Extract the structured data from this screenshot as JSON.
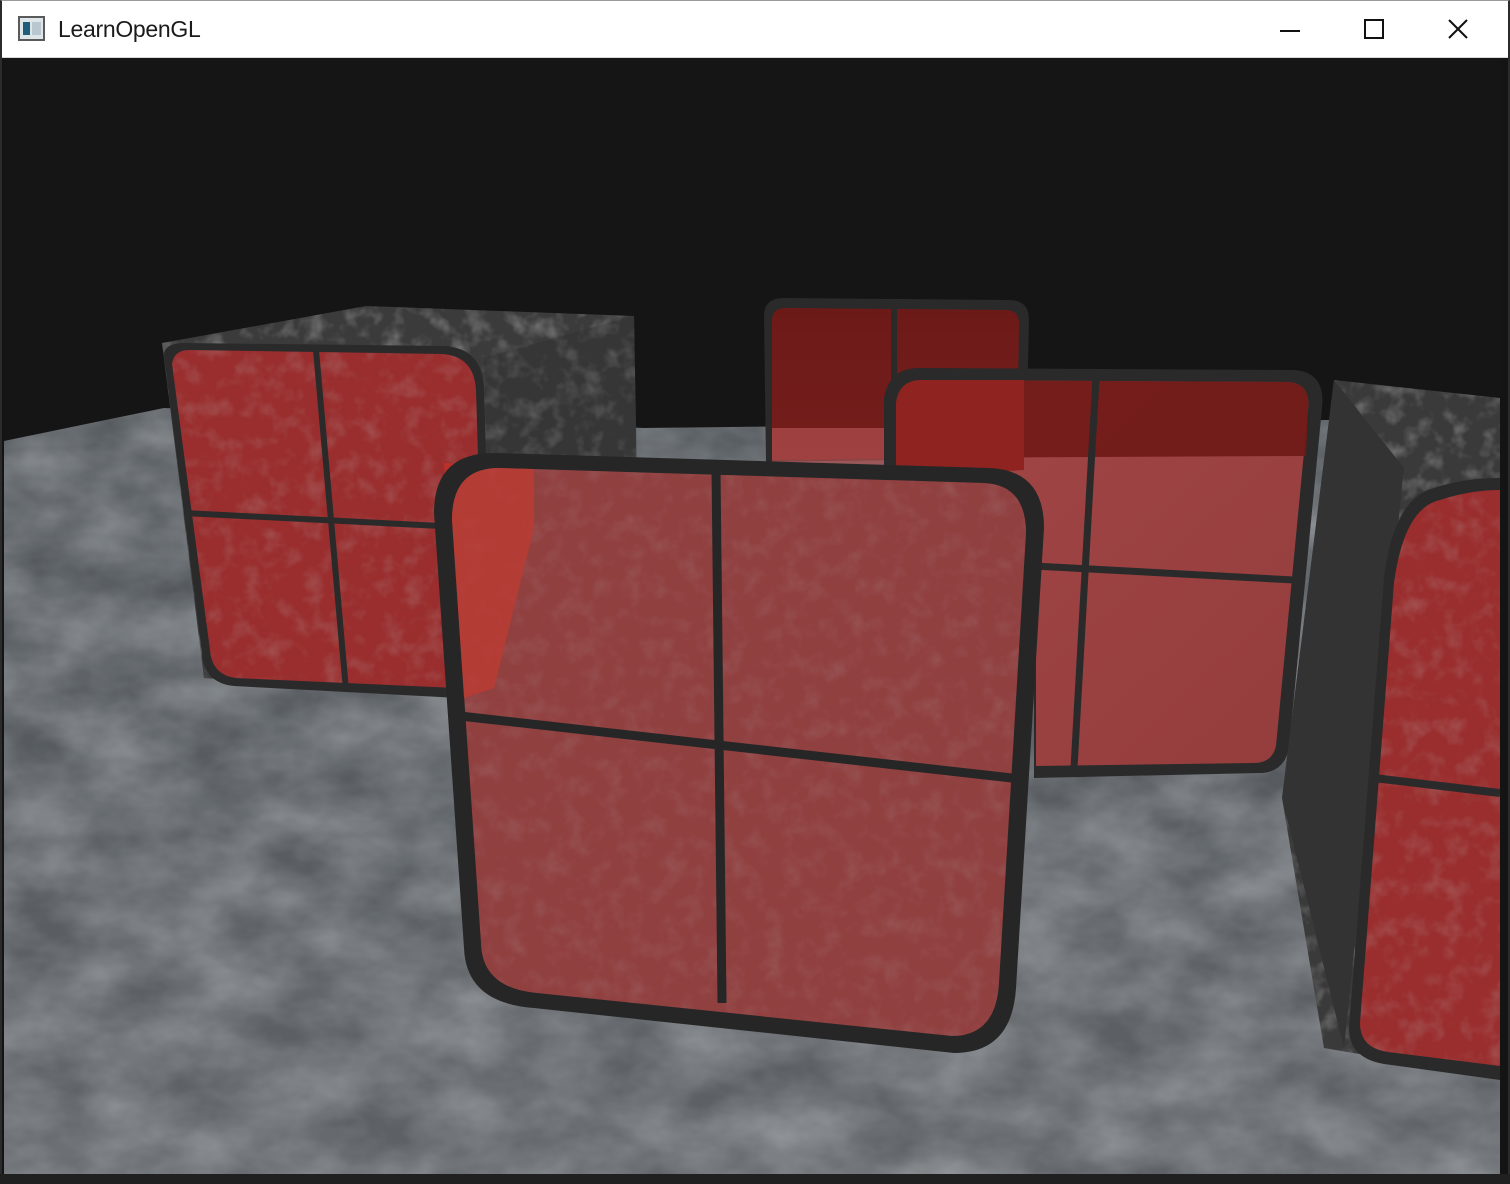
{
  "window": {
    "title": "LearnOpenGL",
    "icon": "app-window-icon",
    "controls": [
      {
        "name": "minimize-button",
        "icon": "minimize-icon"
      },
      {
        "name": "maximize-button",
        "icon": "maximize-icon"
      },
      {
        "name": "close-button",
        "icon": "close-icon"
      }
    ]
  },
  "scene": {
    "background_color": "#141414",
    "floor_color": "#5b5f62",
    "cube_color": "#3e3e3e",
    "window_glass_color": "#b23a3a",
    "window_frame_color": "#262626"
  }
}
